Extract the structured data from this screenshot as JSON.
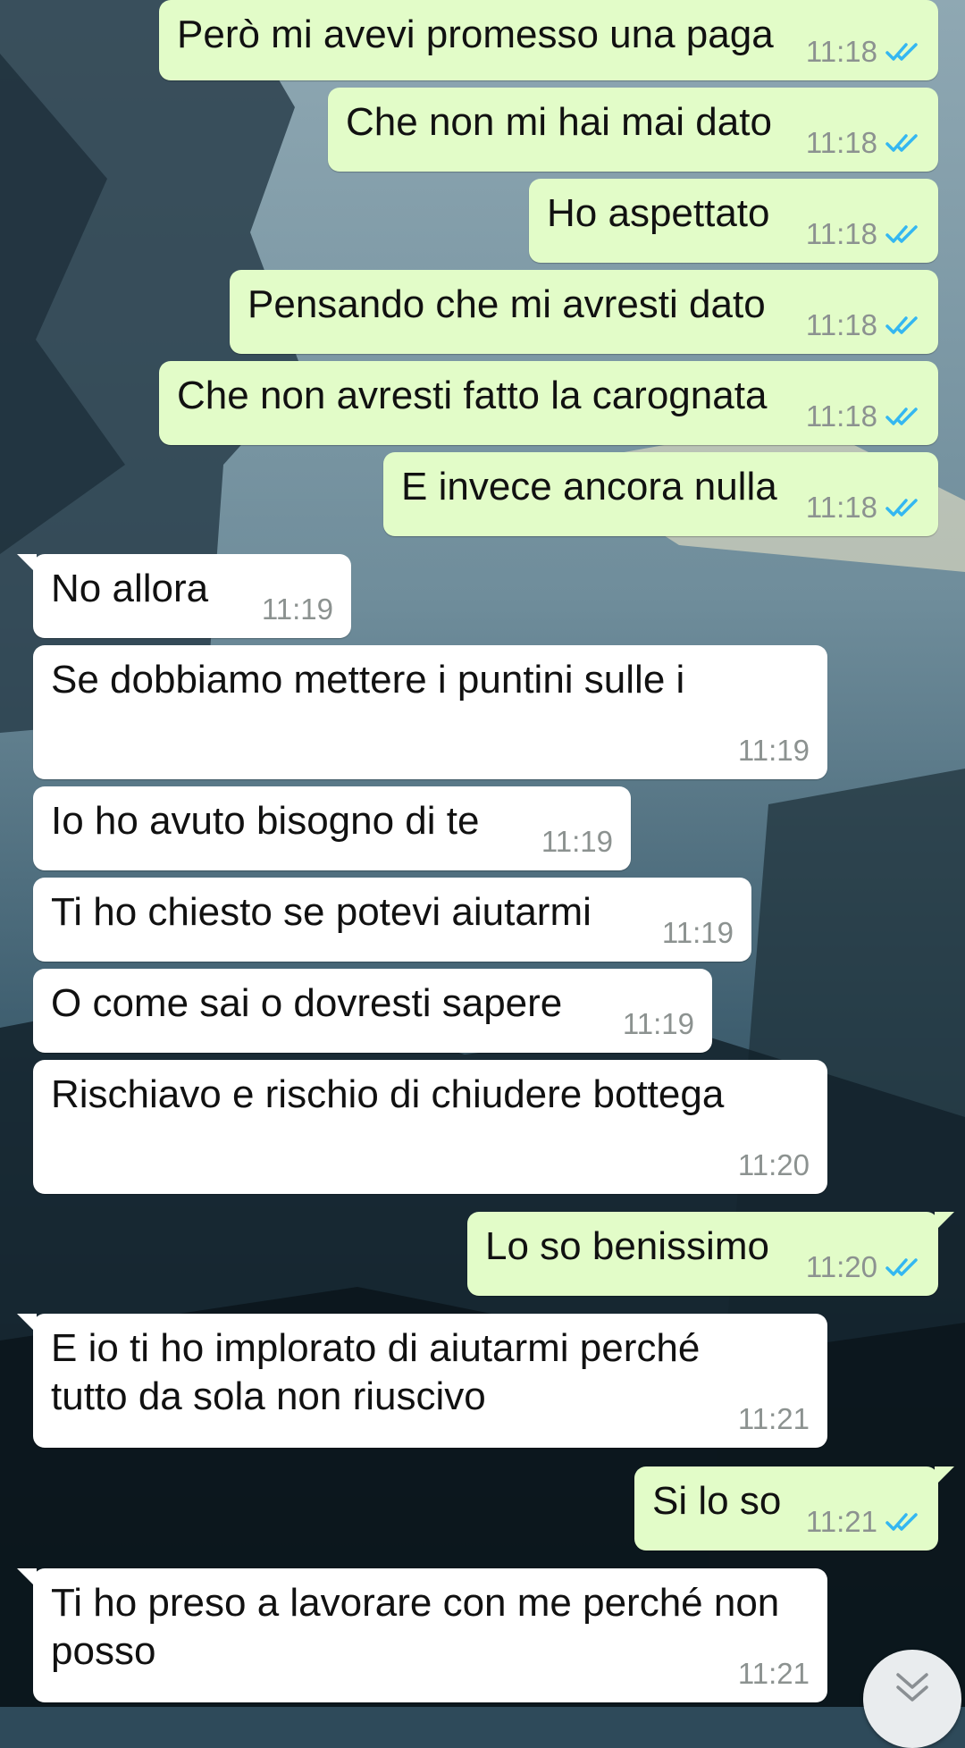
{
  "colors": {
    "outgoing_bubble": "#e2fcc8",
    "incoming_bubble": "#ffffff",
    "timestamp": "#8c9290",
    "read_ticks": "#34b7f1"
  },
  "messages": [
    {
      "direction": "out",
      "text": "Però mi avevi promesso una paga",
      "time": "11:18",
      "status": "read"
    },
    {
      "direction": "out",
      "text": "Che non mi hai mai dato",
      "time": "11:18",
      "status": "read"
    },
    {
      "direction": "out",
      "text": "Ho aspettato",
      "time": "11:18",
      "status": "read"
    },
    {
      "direction": "out",
      "text": "Pensando che mi avresti dato",
      "time": "11:18",
      "status": "read"
    },
    {
      "direction": "out",
      "text": "Che non avresti fatto la carognata",
      "time": "11:18",
      "status": "read"
    },
    {
      "direction": "out",
      "text": "E invece ancora nulla",
      "time": "11:18",
      "status": "read"
    },
    {
      "direction": "in",
      "text": "No allora",
      "time": "11:19"
    },
    {
      "direction": "in",
      "text": "Se dobbiamo mettere i puntini sulle i",
      "time": "11:19"
    },
    {
      "direction": "in",
      "text": "Io ho avuto bisogno di te",
      "time": "11:19"
    },
    {
      "direction": "in",
      "text": "Ti ho chiesto se potevi aiutarmi",
      "time": "11:19"
    },
    {
      "direction": "in",
      "text": "O come sai o dovresti sapere",
      "time": "11:19"
    },
    {
      "direction": "in",
      "text": "Rischiavo e rischio di chiudere bottega",
      "time": "11:20"
    },
    {
      "direction": "out",
      "text": "Lo so benissimo",
      "time": "11:20",
      "status": "read"
    },
    {
      "direction": "in",
      "text": "E io ti ho implorato di aiutarmi perché\ntutto da sola non riuscivo",
      "time": "11:21"
    },
    {
      "direction": "out",
      "text": "Si lo so",
      "time": "11:21",
      "status": "read"
    },
    {
      "direction": "in",
      "text": "Ti ho preso a lavorare con me perché non\nposso",
      "time": "11:21"
    }
  ],
  "scroll_button": {
    "icon": "double-chevron-down-icon"
  }
}
